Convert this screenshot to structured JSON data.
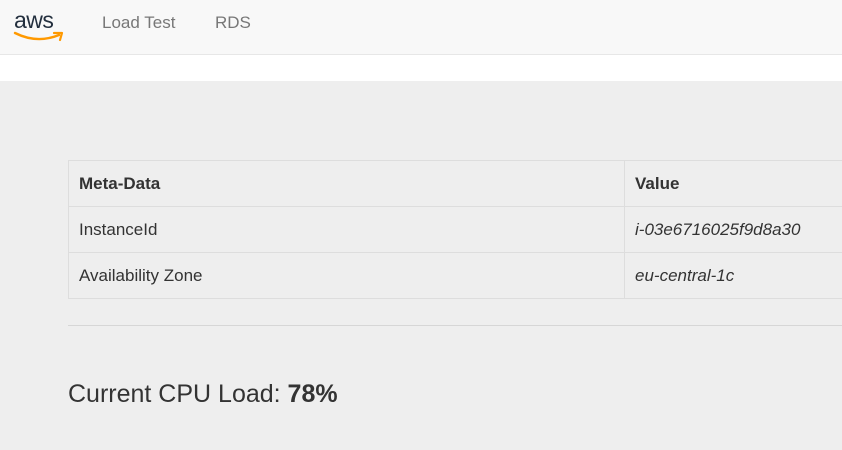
{
  "navbar": {
    "brand": "aws",
    "links": [
      "Load Test",
      "RDS"
    ]
  },
  "table": {
    "headers": [
      "Meta-Data",
      "Value"
    ],
    "rows": [
      [
        "InstanceId",
        "i-03e6716025f9d8a30"
      ],
      [
        "Availability Zone",
        "eu-central-1c"
      ]
    ]
  },
  "cpu": {
    "label": "Current CPU Load: ",
    "value": "78%"
  },
  "colors": {
    "navbar_bg": "#f8f8f8",
    "page_bg": "#eeeeee",
    "aws_smile": "#ff9900",
    "aws_text": "#232f3e"
  }
}
